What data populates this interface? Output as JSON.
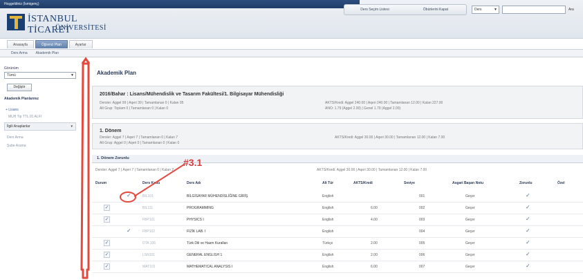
{
  "header": {
    "user_strip": "Hoşgeldiniz (İsmigenç)",
    "links": [
      "Ders Seçim Listesi",
      "Öbürlerini Kapat"
    ],
    "language": "Ders",
    "search_button": "Ara",
    "logo_line1": "İSTANBUL TİCARET",
    "logo_line2": "ÜNİVERSİTESİ"
  },
  "tabs": [
    {
      "label": "Anasayfa",
      "active": false
    },
    {
      "label": "Öğrenci Plan",
      "active": true
    },
    {
      "label": "Ayarlar",
      "active": false
    }
  ],
  "subnav": [
    "Ders Arma",
    "Akademik Plan"
  ],
  "sidebar": {
    "filter_label": "Görünüm",
    "filter_value": "Tümü",
    "apply_button": "Değiştir",
    "title": "Akademik Planlarınız",
    "tree_root": "+ Lisans",
    "tree_child": "MUH Tip TTL 01 ALFI",
    "field_value": "İlgili Anaplanlar",
    "items": [
      "Ders Arma",
      "Şube Arama"
    ]
  },
  "main": {
    "title": "Akademik Plan",
    "panel1": {
      "title": "2016/Bahar : Lisans/Mühendislik ve Tasarım Fakültesi/1. Bilgisayar Mühendisliği",
      "left_line1": "Dersler: Aggel 99 | Aqeri 39 | Tamamlanan 0 | Kalan 95",
      "left_line2": "Alt Grup: Toplam 0 | Tamamlanan 0 | Kalan 0",
      "right_line1": "AKTS/Kredi: Aggel 240.00 | Aqeri 240.00 | Tamamlanan 12.00 | Kalan 227.00",
      "right_line2": "ANO: 1.79 (Aggel 2.00) | Genel 1.79 (Aggel 2.00)"
    },
    "panel2": {
      "title": "1. Dönem",
      "left_line1": "Dersler: Aggel 7 | Aqeri 7 | Tamamlanan 0 | Kalan 7",
      "left_line2": "Alt Grup: Aggel 0 | Aqeri 0 | Tamamlanan 0 | Kalan 0",
      "right_line1": "AKTS/Kredi: Aggel 30.00 | Aqeri 30.00 | Tamamlanan 12.00 | Kalan 7.00"
    },
    "section": {
      "title": "1. Dönem Zorunlu",
      "summary_left": "Dersler: Aggel 7 | Aqeri 7 | Tamamlanan 0 | Kalan 2",
      "summary_right": "AKTS/Kredi: Aggel 30.00 | Aqeri 30.00 | Tamamlanan 12.00 | Kalan 7.00"
    },
    "columns": [
      "Durum",
      "Ders Kodu",
      "Ders Adı",
      "Alt Tür",
      "AKTS/Kredi",
      "Seviye",
      "Asgari Başarı Notu",
      "Zorunlu",
      "Özel"
    ],
    "rows": [
      {
        "code": "BIL101",
        "name": "BİLGİSAYAR MÜHENDİSLİĞİNE GİRİŞ",
        "type": "English",
        "credit": "",
        "level": "001",
        "grade": "Geçer",
        "check1": false,
        "check2": "✓"
      },
      {
        "code": "BIL111",
        "name": "PROGRAMMING",
        "type": "English",
        "credit": "6.00",
        "level": "002",
        "grade": "Geçer",
        "check1": true,
        "check2": ""
      },
      {
        "code": "FBP101",
        "name": "PHYSICS I",
        "type": "English",
        "credit": "4.00",
        "level": "003",
        "grade": "Geçer",
        "check1": true,
        "check2": ""
      },
      {
        "code": "FBP102",
        "name": "FİZİK LAB. I",
        "type": "English",
        "credit": "",
        "level": "004",
        "grade": "Geçer",
        "check1": false,
        "check2": "✓"
      },
      {
        "code": "DTA 106",
        "name": "Türk Dili ve Hasm Kuralları",
        "type": "Türkçe",
        "credit": "2.00",
        "level": "005",
        "grade": "Geçer",
        "check1": true,
        "check2": ""
      },
      {
        "code": "LSN101",
        "name": "GENERAL ENGLISH 1",
        "type": "English",
        "credit": "2.00",
        "level": "006",
        "grade": "Geçer",
        "check1": true,
        "check2": ""
      },
      {
        "code": "MAT101",
        "name": "MATHEMATICAL ANALYSIS I",
        "type": "English",
        "credit": "6.00",
        "level": "007",
        "grade": "Geçer",
        "check1": true,
        "check2": ""
      }
    ],
    "required_mark": "✓"
  },
  "annotation": {
    "label": "#3.1",
    "color": "#d63a3a"
  }
}
